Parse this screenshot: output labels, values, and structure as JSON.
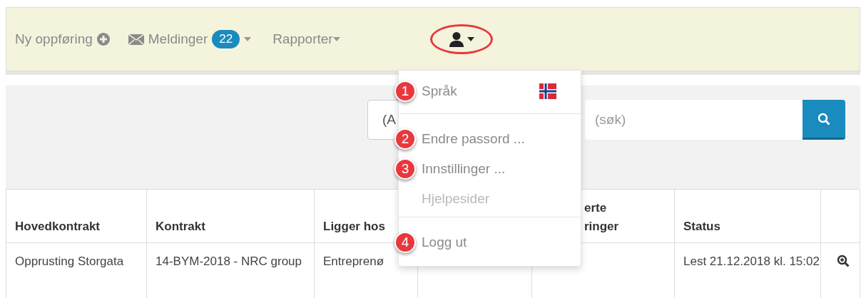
{
  "navbar": {
    "new_entry": {
      "label": "Ny oppføring"
    },
    "messages": {
      "label": "Meldinger",
      "count": "22"
    },
    "reports": {
      "label": "Rapporter"
    },
    "user_menu": {
      "highlighted": true
    }
  },
  "filter": {
    "select_value": "(A",
    "search_placeholder": "(søk)"
  },
  "table": {
    "columns": [
      {
        "label": "Hovedkontrakt"
      },
      {
        "label": "Kontrakt"
      },
      {
        "label": "Ligger hos"
      },
      {},
      {
        "lines": [
          "erte",
          "ringer"
        ]
      },
      {
        "label": "Status"
      },
      {}
    ],
    "rows": [
      {
        "cells": [
          "Opprusting Storgata",
          "14-BYM-2018 - NRC group",
          "Entreprenø",
          "",
          "",
          "Lest 21.12.2018 kl. 15:02"
        ]
      }
    ]
  },
  "dropdown": {
    "groups": [
      [
        {
          "label": "Språk",
          "marker": "1",
          "flag": true,
          "disabled": false
        }
      ],
      [
        {
          "label": "Endre passord ...",
          "marker": "2",
          "flag": false,
          "disabled": false
        },
        {
          "label": "Innstillinger ...",
          "marker": "3",
          "flag": false,
          "disabled": false
        },
        {
          "label": "Hjelpesider",
          "flag": false,
          "disabled": true
        }
      ],
      [
        {
          "label": "Logg ut",
          "marker": "4",
          "flag": false,
          "disabled": false
        }
      ]
    ]
  }
}
